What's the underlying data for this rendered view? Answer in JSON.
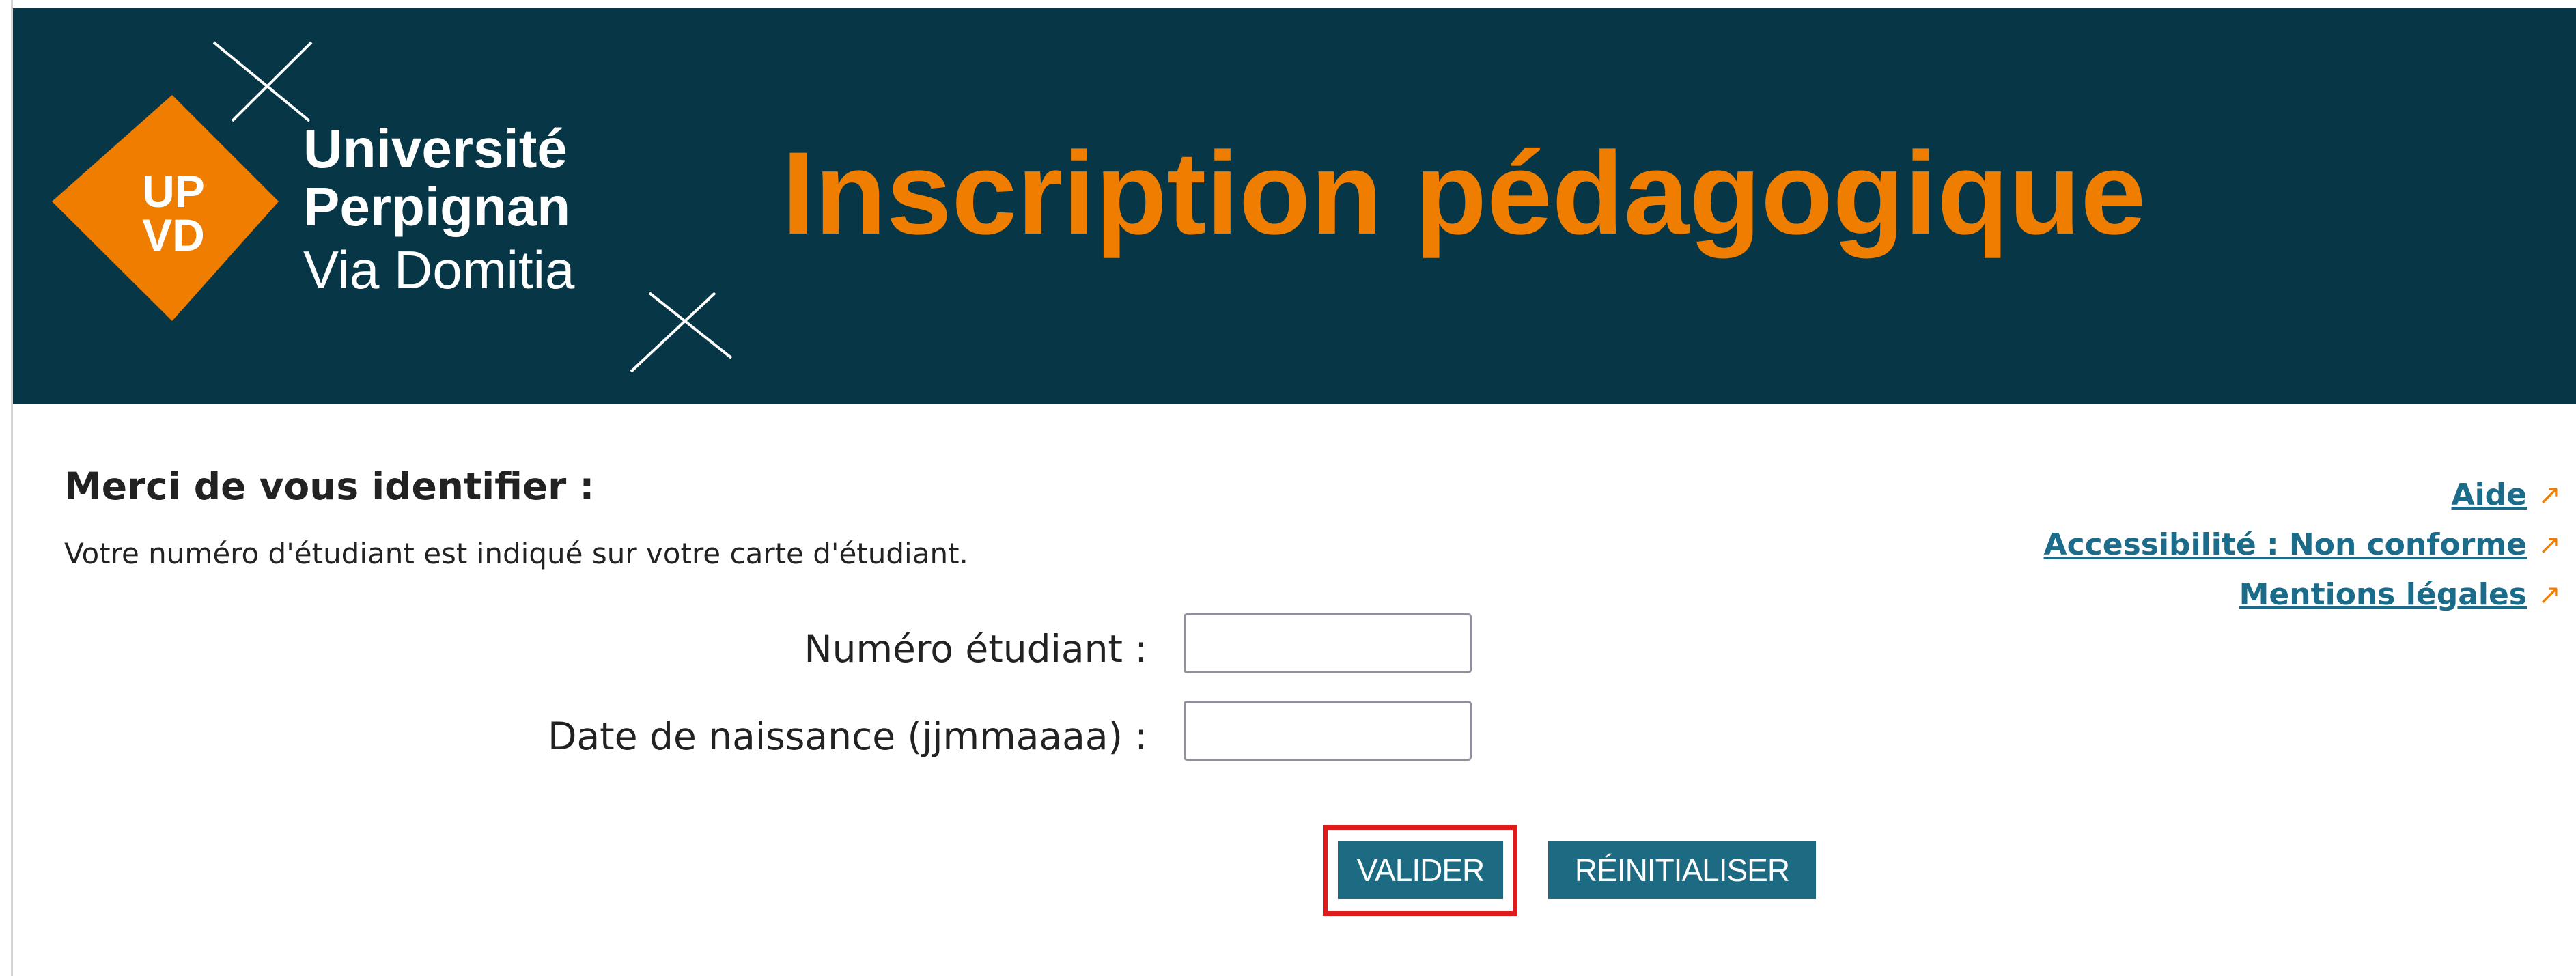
{
  "header": {
    "logo": {
      "badge_line1": "UP",
      "badge_line2": "VD",
      "name_line1": "Université",
      "name_line2": "Perpignan",
      "name_line3": "Via Domitia"
    },
    "title": "Inscription pédagogique"
  },
  "login": {
    "heading": "Merci de vous identifier :",
    "hint": "Votre numéro d'étudiant est indiqué sur votre carte d'étudiant.",
    "student_number_label": "Numéro étudiant :",
    "student_number_value": "",
    "birth_date_label": "Date de naissance (jjmmaaaa) :",
    "birth_date_value": "",
    "validate_label": "VALIDER",
    "reset_label": "RÉINITIALISER"
  },
  "links": {
    "help": "Aide",
    "accessibility": "Accessibilité : Non conforme",
    "legal": "Mentions légales",
    "external_icon": "external-link-arrow"
  },
  "colors": {
    "banner_bg": "#073646",
    "brand_orange": "#ef7d00",
    "link_blue": "#1a6c8a",
    "button_bg": "#1d6a83",
    "highlight_red": "#e01b1b"
  }
}
